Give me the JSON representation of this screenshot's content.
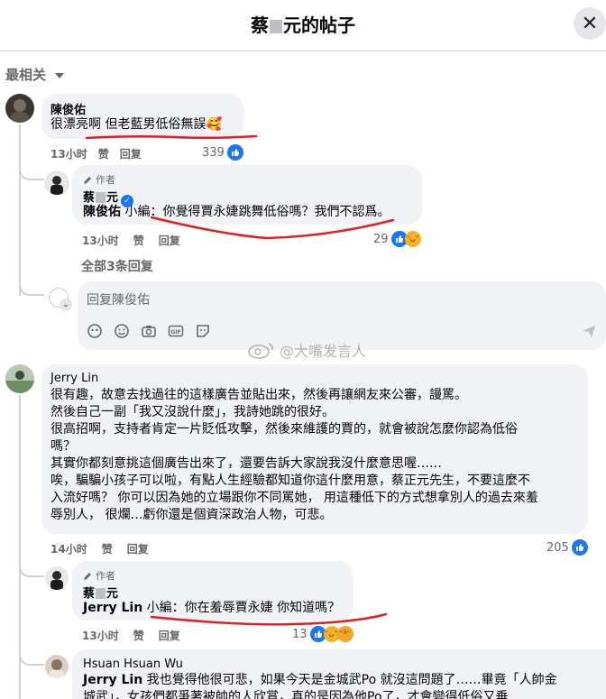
{
  "header": {
    "title_prefix": "蔡",
    "title_suffix": "元的帖子",
    "close_label": "✕"
  },
  "sort": {
    "label": "最相关"
  },
  "comments": [
    {
      "name": "陳俊佑",
      "text": "很漂亮啊 但老藍男低俗無誤🥰",
      "time": "13小时",
      "like": "赞",
      "reply": "回复",
      "reactions": "339",
      "reply_item": {
        "author_tag": "作者",
        "name_prefix": "蔡",
        "name_suffix": "元",
        "mention": "陳俊佑",
        "text": " 小編：你覺得賈永婕跳舞低俗嗎？我們不認爲。",
        "time": "13小时",
        "like": "赞",
        "reply": "回复",
        "reactions": "29"
      },
      "all_replies": "全部3条回复",
      "reply_placeholder": "回复陳俊佑"
    },
    {
      "name": "Jerry Lin",
      "lines": [
        "很有趣，故意去找過往的這樣廣告並貼出來，然後再讓網友來公審，謾罵。",
        "然後自己一副「我又沒說什麼」，我詩她跳的很好。",
        "很高招啊，支持者肯定一片貶低攻擊，然後來維護的賈的，就會被說怎麼你認為低俗",
        "嗎？",
        "其實你都刻意挑這個廣告出來了，還要告訴大家說我沒什麼意思喔……",
        "唉，騙騙小孩子可以啦，有點人生經驗都知道你這什麼用意，蔡正元先生，不要這麼不",
        "入流好嗎？ 你可以因為她的立場跟你不同罵她， 用這種低下的方式想拿別人的過去來羞",
        "辱別人， 很爛…虧你還是個資深政治人物，可悲。"
      ],
      "time": "14小时",
      "like": "赞",
      "reply": "回复",
      "reactions": "205",
      "reply_item": {
        "author_tag": "作者",
        "name_prefix": "蔡",
        "name_suffix": "元",
        "mention": "Jerry Lin",
        "text": " 小編：你在羞辱賈永婕 你知道嗎？",
        "time": "13小时",
        "like": "赞",
        "reply": "回复",
        "reactions": "13"
      }
    },
    {
      "name": "Hsuan Hsuan Wu",
      "mention": "Jerry Lin",
      "line1": " 我也覺得他很可悲，如果今天是金城武Po 就沒這問題了……畢竟「人帥金",
      "line2": "城武」，女孩們都爭著被帥的人欣賞，真的是因為他Po了，才會變得低俗又垂"
    }
  ],
  "watermark": "@大嘴发言人",
  "colors": {
    "underline": "#e02020",
    "link": "#1877f2",
    "secondary": "#65676b"
  }
}
